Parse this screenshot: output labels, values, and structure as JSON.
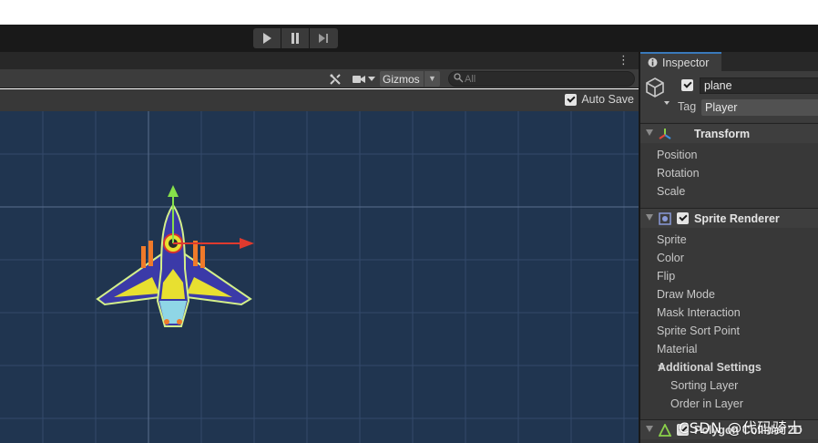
{
  "toolbar": {
    "play": "play-icon",
    "pause": "pause-icon",
    "step": "step-icon"
  },
  "scene": {
    "more_menu": "⋮",
    "gizmos_label": "Gizmos",
    "search_placeholder": "All",
    "autosave_label": "Auto Save",
    "autosave_checked": true,
    "background_color": "#203550"
  },
  "inspector": {
    "tab_label": "Inspector",
    "gameobject": {
      "name": "plane",
      "tag_label": "Tag",
      "tag_value": "Player",
      "active": true
    },
    "transform": {
      "title": "Transform",
      "props": [
        "Position",
        "Rotation",
        "Scale"
      ]
    },
    "sprite_renderer": {
      "title": "Sprite Renderer",
      "enabled": true,
      "props": [
        "Sprite",
        "Color",
        "Flip",
        "Draw Mode",
        "Mask Interaction",
        "Sprite Sort Point",
        "Material"
      ],
      "additional_settings": {
        "title": "Additional Settings",
        "props": [
          "Sorting Layer",
          "Order in Layer"
        ]
      }
    },
    "polygon_collider": {
      "title": "Polygon Collider 2D"
    }
  },
  "watermark": "CSDN @代码骑士"
}
